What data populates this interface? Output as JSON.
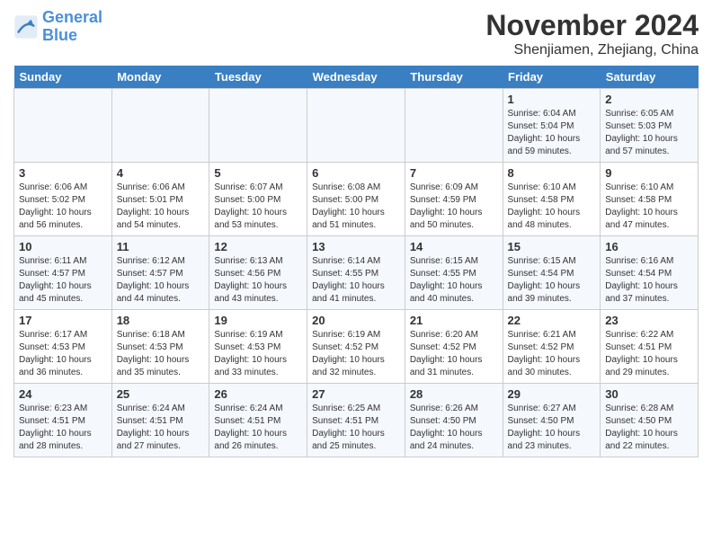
{
  "header": {
    "logo_line1": "General",
    "logo_line2": "Blue",
    "month": "November 2024",
    "location": "Shenjiamen, Zhejiang, China"
  },
  "weekdays": [
    "Sunday",
    "Monday",
    "Tuesday",
    "Wednesday",
    "Thursday",
    "Friday",
    "Saturday"
  ],
  "weeks": [
    [
      {
        "day": "",
        "info": ""
      },
      {
        "day": "",
        "info": ""
      },
      {
        "day": "",
        "info": ""
      },
      {
        "day": "",
        "info": ""
      },
      {
        "day": "",
        "info": ""
      },
      {
        "day": "1",
        "info": "Sunrise: 6:04 AM\nSunset: 5:04 PM\nDaylight: 10 hours\nand 59 minutes."
      },
      {
        "day": "2",
        "info": "Sunrise: 6:05 AM\nSunset: 5:03 PM\nDaylight: 10 hours\nand 57 minutes."
      }
    ],
    [
      {
        "day": "3",
        "info": "Sunrise: 6:06 AM\nSunset: 5:02 PM\nDaylight: 10 hours\nand 56 minutes."
      },
      {
        "day": "4",
        "info": "Sunrise: 6:06 AM\nSunset: 5:01 PM\nDaylight: 10 hours\nand 54 minutes."
      },
      {
        "day": "5",
        "info": "Sunrise: 6:07 AM\nSunset: 5:00 PM\nDaylight: 10 hours\nand 53 minutes."
      },
      {
        "day": "6",
        "info": "Sunrise: 6:08 AM\nSunset: 5:00 PM\nDaylight: 10 hours\nand 51 minutes."
      },
      {
        "day": "7",
        "info": "Sunrise: 6:09 AM\nSunset: 4:59 PM\nDaylight: 10 hours\nand 50 minutes."
      },
      {
        "day": "8",
        "info": "Sunrise: 6:10 AM\nSunset: 4:58 PM\nDaylight: 10 hours\nand 48 minutes."
      },
      {
        "day": "9",
        "info": "Sunrise: 6:10 AM\nSunset: 4:58 PM\nDaylight: 10 hours\nand 47 minutes."
      }
    ],
    [
      {
        "day": "10",
        "info": "Sunrise: 6:11 AM\nSunset: 4:57 PM\nDaylight: 10 hours\nand 45 minutes."
      },
      {
        "day": "11",
        "info": "Sunrise: 6:12 AM\nSunset: 4:57 PM\nDaylight: 10 hours\nand 44 minutes."
      },
      {
        "day": "12",
        "info": "Sunrise: 6:13 AM\nSunset: 4:56 PM\nDaylight: 10 hours\nand 43 minutes."
      },
      {
        "day": "13",
        "info": "Sunrise: 6:14 AM\nSunset: 4:55 PM\nDaylight: 10 hours\nand 41 minutes."
      },
      {
        "day": "14",
        "info": "Sunrise: 6:15 AM\nSunset: 4:55 PM\nDaylight: 10 hours\nand 40 minutes."
      },
      {
        "day": "15",
        "info": "Sunrise: 6:15 AM\nSunset: 4:54 PM\nDaylight: 10 hours\nand 39 minutes."
      },
      {
        "day": "16",
        "info": "Sunrise: 6:16 AM\nSunset: 4:54 PM\nDaylight: 10 hours\nand 37 minutes."
      }
    ],
    [
      {
        "day": "17",
        "info": "Sunrise: 6:17 AM\nSunset: 4:53 PM\nDaylight: 10 hours\nand 36 minutes."
      },
      {
        "day": "18",
        "info": "Sunrise: 6:18 AM\nSunset: 4:53 PM\nDaylight: 10 hours\nand 35 minutes."
      },
      {
        "day": "19",
        "info": "Sunrise: 6:19 AM\nSunset: 4:53 PM\nDaylight: 10 hours\nand 33 minutes."
      },
      {
        "day": "20",
        "info": "Sunrise: 6:19 AM\nSunset: 4:52 PM\nDaylight: 10 hours\nand 32 minutes."
      },
      {
        "day": "21",
        "info": "Sunrise: 6:20 AM\nSunset: 4:52 PM\nDaylight: 10 hours\nand 31 minutes."
      },
      {
        "day": "22",
        "info": "Sunrise: 6:21 AM\nSunset: 4:52 PM\nDaylight: 10 hours\nand 30 minutes."
      },
      {
        "day": "23",
        "info": "Sunrise: 6:22 AM\nSunset: 4:51 PM\nDaylight: 10 hours\nand 29 minutes."
      }
    ],
    [
      {
        "day": "24",
        "info": "Sunrise: 6:23 AM\nSunset: 4:51 PM\nDaylight: 10 hours\nand 28 minutes."
      },
      {
        "day": "25",
        "info": "Sunrise: 6:24 AM\nSunset: 4:51 PM\nDaylight: 10 hours\nand 27 minutes."
      },
      {
        "day": "26",
        "info": "Sunrise: 6:24 AM\nSunset: 4:51 PM\nDaylight: 10 hours\nand 26 minutes."
      },
      {
        "day": "27",
        "info": "Sunrise: 6:25 AM\nSunset: 4:51 PM\nDaylight: 10 hours\nand 25 minutes."
      },
      {
        "day": "28",
        "info": "Sunrise: 6:26 AM\nSunset: 4:50 PM\nDaylight: 10 hours\nand 24 minutes."
      },
      {
        "day": "29",
        "info": "Sunrise: 6:27 AM\nSunset: 4:50 PM\nDaylight: 10 hours\nand 23 minutes."
      },
      {
        "day": "30",
        "info": "Sunrise: 6:28 AM\nSunset: 4:50 PM\nDaylight: 10 hours\nand 22 minutes."
      }
    ]
  ]
}
